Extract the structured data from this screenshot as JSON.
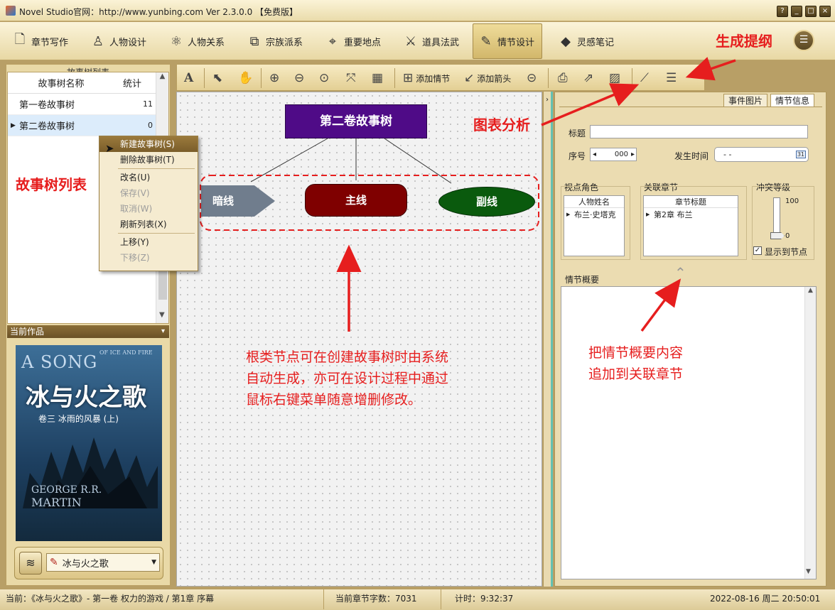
{
  "window": {
    "title": "Novel Studio官网：http://www.yunbing.com Ver 2.3.0.0 【免费版】",
    "buttons": [
      "?",
      "_",
      "□",
      "×"
    ]
  },
  "menu": [
    {
      "label": "章节写作",
      "icon": "document-icon"
    },
    {
      "label": "人物设计",
      "icon": "person-icon"
    },
    {
      "label": "人物关系",
      "icon": "relation-icon"
    },
    {
      "label": "宗族派系",
      "icon": "org-icon"
    },
    {
      "label": "重要地点",
      "icon": "location-icon"
    },
    {
      "label": "道具法武",
      "icon": "weapon-icon"
    },
    {
      "label": "情节设计",
      "icon": "edit-icon",
      "active": true
    },
    {
      "label": "灵感笔记",
      "icon": "diamond-icon"
    }
  ],
  "left": {
    "tree_title": "故事树列表",
    "col_name": "故事树名称",
    "col_count": "统计",
    "rows": [
      {
        "name": "第一卷故事树",
        "count": "11"
      },
      {
        "name": "第二卷故事树",
        "count": "0"
      }
    ],
    "current_work_title": "当前作品",
    "cover": {
      "line1": "A SONG",
      "line1b": "OF ICE AND FIRE",
      "cn_title": "冰与火之歌",
      "sub": "卷三 冰雨的风暴 (上)",
      "author1": "GEORGE R.R.",
      "author2": "MARTIN"
    },
    "work_select": "冰与火之歌"
  },
  "context_menu": [
    {
      "label": "新建故事树(S)",
      "state": "hl"
    },
    {
      "label": "删除故事树(T)",
      "state": ""
    },
    {
      "sep": true
    },
    {
      "label": "改名(U)",
      "state": ""
    },
    {
      "label": "保存(V)",
      "state": "dis"
    },
    {
      "label": "取消(W)",
      "state": "dis"
    },
    {
      "label": "刷新列表(X)",
      "state": ""
    },
    {
      "sep": true
    },
    {
      "label": "上移(Y)",
      "state": ""
    },
    {
      "label": "下移(Z)",
      "state": "dis"
    }
  ],
  "toolbar": {
    "add_plot": "添加情节",
    "add_arrow": "添加箭头"
  },
  "diagram": {
    "root": "第二卷故事树",
    "dark": "暗线",
    "main": "主线",
    "sub": "副线"
  },
  "right": {
    "tabs": [
      "事件图片",
      "情节信息"
    ],
    "title_label": "标题",
    "seq_label": "序号",
    "seq_value": "000",
    "time_label": "发生时间",
    "time_value": "- -",
    "cal": "31",
    "pov_group": "视点角色",
    "pov_col": "人物姓名",
    "pov_row": "布兰·史塔克",
    "chap_group": "关联章节",
    "chap_col": "章节标题",
    "chap_row": "第2章 布兰",
    "conflict_group": "冲突等级",
    "conflict_max": "100",
    "conflict_min": "0",
    "conflict_level": 0,
    "show_label": "显示到节点",
    "summary_label": "情节概要"
  },
  "annotations": {
    "gen_outline": "生成提纲",
    "chart": "图表分析",
    "tree_list": "故事树列表",
    "root_note": [
      "根类节点可在创建故事树时由系统",
      "自动生成，亦可在设计过程中通过",
      "鼠标右键菜单随意增删修改。"
    ],
    "summary_note": [
      "把情节概要内容",
      "追加到关联章节"
    ]
  },
  "status": {
    "current": "当前：《冰与火之歌》- 第一卷 权力的游戏 / 第1章 序幕",
    "words": "当前章节字数：7031",
    "timer": "计时：9:32:37",
    "datetime": "2022-08-16 周二 20:50:01"
  },
  "colors": {
    "root": "#4f0b87",
    "dark": "#707d8d",
    "main": "#7f0000",
    "sub": "#0a5a0d",
    "annotation": "#e61e1e"
  }
}
